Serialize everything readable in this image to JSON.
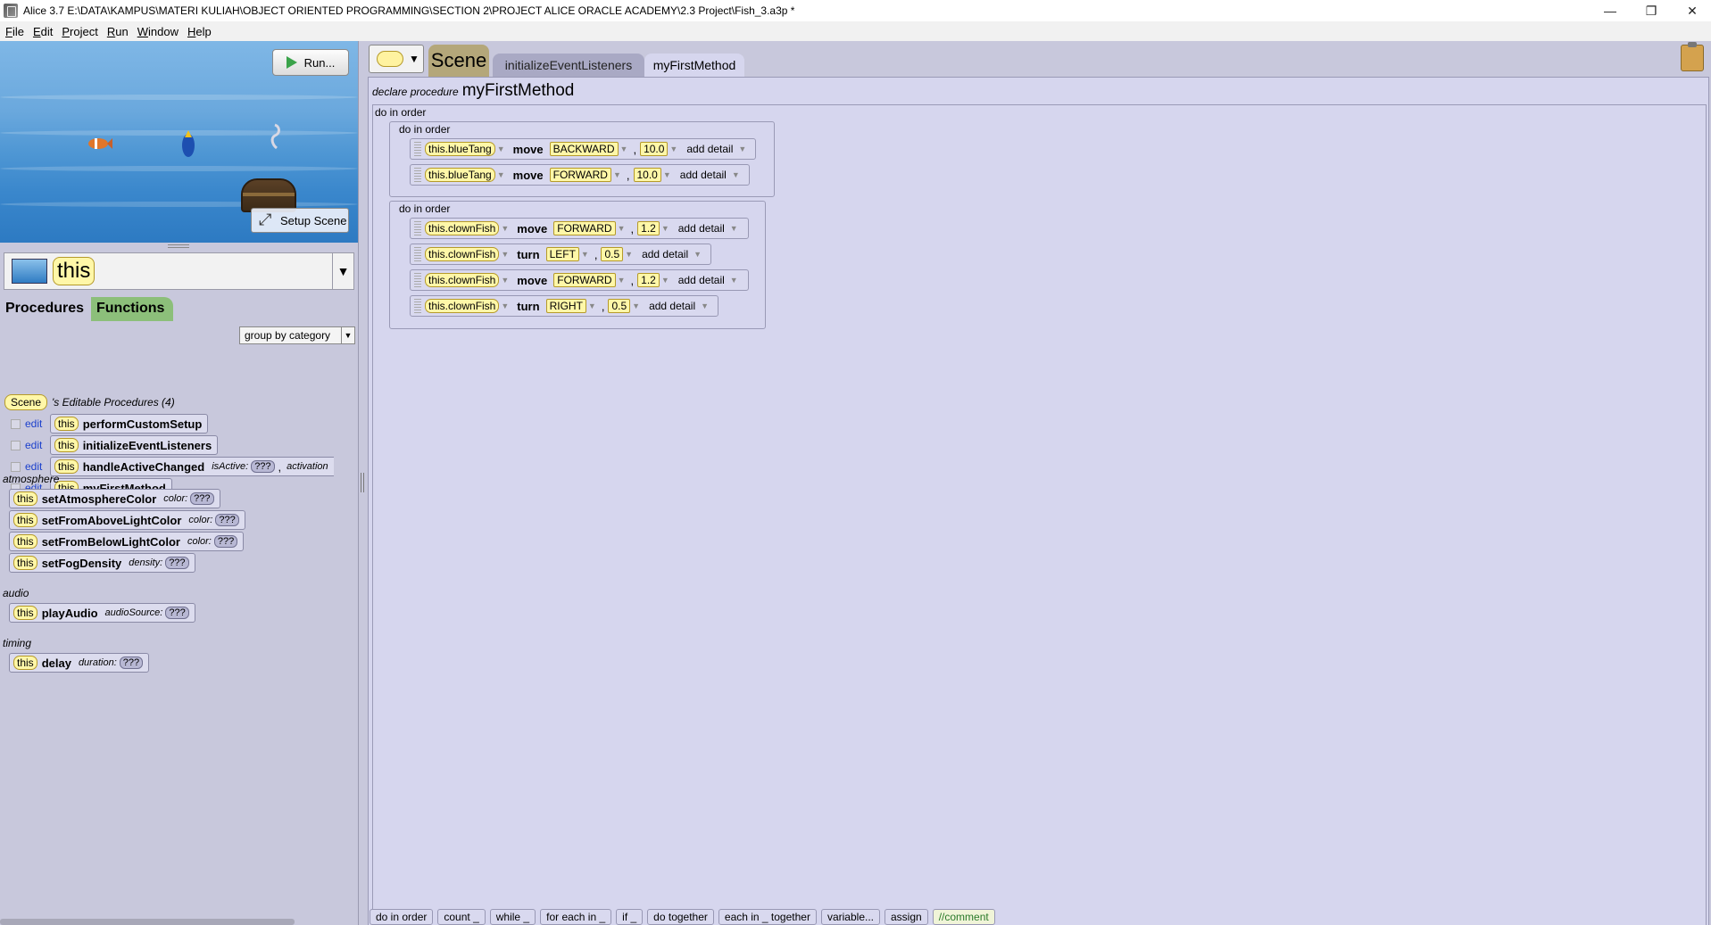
{
  "window": {
    "title": "Alice 3.7 E:\\DATA\\KAMPUS\\MATERI KULIAH\\OBJECT ORIENTED PROGRAMMING\\SECTION 2\\PROJECT ALICE ORACLE ACADEMY\\2.3 Project\\Fish_3.a3p *",
    "controls": {
      "minimize": "—",
      "restore": "❐",
      "close": "✕"
    }
  },
  "menubar": [
    "File",
    "Edit",
    "Project",
    "Run",
    "Window",
    "Help"
  ],
  "preview": {
    "run_label": "Run...",
    "setup_scene_label": "Setup Scene"
  },
  "selector": {
    "label": "this",
    "arrow": "▼"
  },
  "left_tabs": {
    "procedures": "Procedures",
    "functions": "Functions"
  },
  "group_by": {
    "value": "group by category"
  },
  "editable": {
    "scene_chip": "Scene",
    "label": "'s Editable Procedures (4)",
    "edit_label": "edit",
    "this_label": "this",
    "items": [
      {
        "name": "performCustomSetup"
      },
      {
        "name": "initializeEventListeners"
      },
      {
        "name": "handleActiveChanged",
        "param1": "isActive:",
        "param1_value": "???",
        "param2": "activation"
      },
      {
        "name": "myFirstMethod"
      }
    ]
  },
  "categories": {
    "atmosphere": {
      "label": "atmosphere",
      "items": [
        {
          "name": "setAtmosphereColor",
          "param": "color:",
          "value": "???"
        },
        {
          "name": "setFromAboveLightColor",
          "param": "color:",
          "value": "???"
        },
        {
          "name": "setFromBelowLightColor",
          "param": "color:",
          "value": "???"
        },
        {
          "name": "setFogDensity",
          "param": "density:",
          "value": "???"
        }
      ]
    },
    "audio": {
      "label": "audio",
      "items": [
        {
          "name": "playAudio",
          "param": "audioSource:",
          "value": "???"
        }
      ]
    },
    "timing": {
      "label": "timing",
      "items": [
        {
          "name": "delay",
          "param": "duration:",
          "value": "???"
        }
      ]
    }
  },
  "editor": {
    "tabs": {
      "scene": "Scene",
      "init": "initializeEventListeners",
      "myfirst": "myFirstMethod"
    },
    "declare_kw": "declare procedure",
    "method_name": "myFirstMethod",
    "do_in_order": "do in order",
    "block1": [
      {
        "target": "this.blueTang",
        "verb": "move",
        "direction": "BACKWARD",
        "amount": "10.0",
        "detail": "add detail"
      },
      {
        "target": "this.blueTang",
        "verb": "move",
        "direction": "FORWARD",
        "amount": "10.0",
        "detail": "add detail"
      }
    ],
    "block2": [
      {
        "target": "this.clownFish",
        "verb": "move",
        "direction": "FORWARD",
        "amount": "1.2",
        "detail": "add detail"
      },
      {
        "target": "this.clownFish",
        "verb": "turn",
        "direction": "LEFT",
        "amount": "0.5",
        "detail": "add detail"
      },
      {
        "target": "this.clownFish",
        "verb": "move",
        "direction": "FORWARD",
        "amount": "1.2",
        "detail": "add detail"
      },
      {
        "target": "this.clownFish",
        "verb": "turn",
        "direction": "RIGHT",
        "amount": "0.5",
        "detail": "add detail"
      }
    ]
  },
  "palette": [
    "do in order",
    "count _",
    "while _",
    "for each in _",
    "if _",
    "do together",
    "each in _ together",
    "variable...",
    "assign",
    "//comment"
  ]
}
